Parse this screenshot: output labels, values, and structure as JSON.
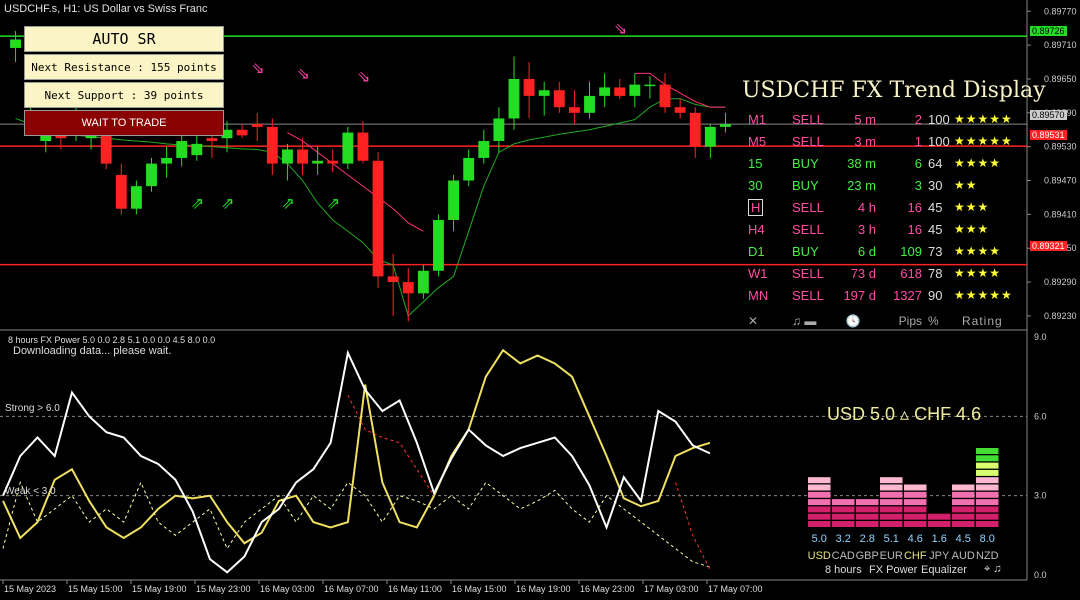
{
  "header": {
    "title": "USDCHF.s, H1:  US Dollar vs Swiss Franc"
  },
  "auto_sr": {
    "title": "AUTO SR",
    "resistance": "Next Resistance : 155 points",
    "support": "Next Support : 39 points",
    "status": "WAIT TO TRADE"
  },
  "trend_display": {
    "title": "USDCHF FX Trend Display",
    "rows": [
      {
        "tf": "M1",
        "signal": "SELL",
        "dur": "5 m",
        "pips": "2",
        "pct": "100",
        "stars": "★★★★★",
        "color": "#ff4da6"
      },
      {
        "tf": "M5",
        "signal": "SELL",
        "dur": "3 m",
        "pips": "1",
        "pct": "100",
        "stars": "★★★★★",
        "color": "#ff4da6"
      },
      {
        "tf": "15",
        "signal": "BUY",
        "dur": "38 m",
        "pips": "6",
        "pct": "64",
        "stars": "★★★★",
        "color": "#44ee44"
      },
      {
        "tf": "30",
        "signal": "BUY",
        "dur": "23 m",
        "pips": "3",
        "pct": "30",
        "stars": "★★",
        "color": "#44ee44"
      },
      {
        "tf": "H",
        "signal": "SELL",
        "dur": "4 h",
        "pips": "16",
        "pct": "45",
        "stars": "★★★",
        "color": "#ff4da6"
      },
      {
        "tf": "H4",
        "signal": "SELL",
        "dur": "3 h",
        "pips": "16",
        "pct": "45",
        "stars": "★★★",
        "color": "#ff4da6"
      },
      {
        "tf": "D1",
        "signal": "BUY",
        "dur": "6 d",
        "pips": "109",
        "pct": "73",
        "stars": "★★★★",
        "color": "#44ee44"
      },
      {
        "tf": "W1",
        "signal": "SELL",
        "dur": "73 d",
        "pips": "618",
        "pct": "78",
        "stars": "★★★★",
        "color": "#ff4da6"
      },
      {
        "tf": "MN",
        "signal": "SELL",
        "dur": "197 d",
        "pips": "1327",
        "pct": "90",
        "stars": "★★★★★",
        "color": "#ff4da6"
      }
    ],
    "footer": {
      "close": "✕",
      "sound": "♫ ▬",
      "clock": "🕓",
      "pips": "Pips",
      "pct": "%",
      "rating": "Rating"
    }
  },
  "subwindow": {
    "title": "8 hours FX Power 5.0 0.0 2.8 5.1 0.0 0.0 4.5 8.0 0.0",
    "message": "Downloading data... please wait.",
    "strong_label": "Strong > 6.0",
    "weak_label": "Weak < 3.0",
    "usd_chf": "USD 5.0  ▵  CHF 4.6",
    "footer": {
      "period": "8 hours",
      "name": "FX Power",
      "mode": "Equalizer",
      "icons": "⌖ ♫"
    }
  },
  "price_tags": {
    "resistance": "0.89726",
    "current": "0.89570",
    "mid": "0.89531",
    "support": "0.89321"
  },
  "chart_data": [
    {
      "type": "candlestick",
      "title": "USDCHF.s, H1",
      "y_ticks": [
        "0.89770",
        "0.89710",
        "0.89650",
        "0.89590",
        "0.89530",
        "0.89470",
        "0.89410",
        "0.89350",
        "0.89290",
        "0.89230"
      ],
      "ylim": [
        0.89205,
        0.8979
      ],
      "x_ticks": [
        "15 May 2023",
        "15 May 15:00",
        "15 May 19:00",
        "15 May 23:00",
        "16 May 03:00",
        "16 May 07:00",
        "16 May 11:00",
        "16 May 15:00",
        "16 May 19:00",
        "16 May 23:00",
        "17 May 03:00",
        "17 May 07:00"
      ],
      "levels": {
        "resistance": 0.89726,
        "current": 0.8957,
        "mid": 0.89531,
        "support": 0.89321
      },
      "colors": {
        "bull": "#22dd22",
        "bear": "#ff2222",
        "resistance": "#22dd22",
        "support": "#ff2222",
        "signal_line": "#22aa22"
      },
      "candles": [
        [
          0.89705,
          0.89735,
          0.8968,
          0.8972
        ],
        [
          0.896,
          0.8964,
          0.89575,
          0.89615
        ],
        [
          0.8954,
          0.8958,
          0.8952,
          0.89565
        ],
        [
          0.89555,
          0.89585,
          0.89525,
          0.89545
        ],
        [
          0.8956,
          0.896,
          0.8954,
          0.8958
        ],
        [
          0.89545,
          0.89585,
          0.89525,
          0.8956
        ],
        [
          0.8956,
          0.8958,
          0.8949,
          0.895
        ],
        [
          0.8948,
          0.895,
          0.8941,
          0.8942
        ],
        [
          0.8942,
          0.8947,
          0.8941,
          0.8946
        ],
        [
          0.8946,
          0.8951,
          0.8945,
          0.895
        ],
        [
          0.895,
          0.8953,
          0.89475,
          0.8951
        ],
        [
          0.8951,
          0.8955,
          0.89495,
          0.8954
        ],
        [
          0.89515,
          0.8956,
          0.89505,
          0.89535
        ],
        [
          0.89545,
          0.8957,
          0.8951,
          0.8954
        ],
        [
          0.89545,
          0.89575,
          0.8952,
          0.8956
        ],
        [
          0.8956,
          0.8957,
          0.89545,
          0.8955
        ],
        [
          0.8957,
          0.8959,
          0.8954,
          0.89565
        ],
        [
          0.89565,
          0.8958,
          0.8948,
          0.895
        ],
        [
          0.895,
          0.89535,
          0.8947,
          0.89525
        ],
        [
          0.89525,
          0.89545,
          0.8948,
          0.895
        ],
        [
          0.895,
          0.8953,
          0.8948,
          0.89505
        ],
        [
          0.89505,
          0.89525,
          0.89485,
          0.895
        ],
        [
          0.895,
          0.89565,
          0.8949,
          0.89555
        ],
        [
          0.89555,
          0.89575,
          0.895,
          0.89505
        ],
        [
          0.89505,
          0.8952,
          0.8928,
          0.893
        ],
        [
          0.893,
          0.8934,
          0.8923,
          0.8929
        ],
        [
          0.8929,
          0.89315,
          0.8922,
          0.8927
        ],
        [
          0.8927,
          0.8932,
          0.8926,
          0.8931
        ],
        [
          0.8931,
          0.8941,
          0.893,
          0.894
        ],
        [
          0.894,
          0.8948,
          0.8938,
          0.8947
        ],
        [
          0.8947,
          0.89525,
          0.8946,
          0.8951
        ],
        [
          0.8951,
          0.8956,
          0.895,
          0.8954
        ],
        [
          0.8954,
          0.896,
          0.8952,
          0.8958
        ],
        [
          0.8958,
          0.8969,
          0.8956,
          0.8965
        ],
        [
          0.8965,
          0.8968,
          0.8958,
          0.8962
        ],
        [
          0.8962,
          0.89645,
          0.89585,
          0.8963
        ],
        [
          0.8963,
          0.89645,
          0.8959,
          0.896
        ],
        [
          0.896,
          0.8963,
          0.8957,
          0.8959
        ],
        [
          0.8959,
          0.89645,
          0.8958,
          0.8962
        ],
        [
          0.8962,
          0.8966,
          0.896,
          0.89635
        ],
        [
          0.89635,
          0.8965,
          0.89615,
          0.8962
        ],
        [
          0.8962,
          0.8966,
          0.896,
          0.8964
        ],
        [
          0.8964,
          0.89655,
          0.89615,
          0.8964
        ],
        [
          0.8964,
          0.8966,
          0.8959,
          0.896
        ],
        [
          0.896,
          0.89615,
          0.8958,
          0.8959
        ],
        [
          0.8959,
          0.896,
          0.8951,
          0.8953
        ],
        [
          0.8953,
          0.8957,
          0.8951,
          0.89565
        ],
        [
          0.89565,
          0.8959,
          0.89555,
          0.8957
        ]
      ],
      "signal_line": [
        0.8958,
        0.8957,
        0.8956,
        0.89555,
        0.8955,
        0.89548,
        0.89545,
        0.89542,
        0.8954,
        0.89538,
        0.89535,
        0.89533,
        0.89532,
        0.8953,
        0.89528,
        0.89526,
        0.89525,
        0.8952,
        0.895,
        0.8947,
        0.8943,
        0.894,
        0.8938,
        0.8936,
        0.8933,
        0.8932,
        0.8923,
        0.89255,
        0.8928,
        0.893,
        0.8938,
        0.8946,
        0.8952,
        0.89535,
        0.89542,
        0.89547,
        0.89552,
        0.89556,
        0.8956,
        0.89566,
        0.89572,
        0.89578,
        0.896,
        0.89615,
        0.89615,
        0.89605,
        0.896,
        0.896
      ],
      "pink_line": [
        null,
        null,
        null,
        null,
        null,
        null,
        null,
        null,
        null,
        null,
        null,
        null,
        null,
        null,
        null,
        null,
        null,
        null,
        0.89555,
        0.8954,
        0.8952,
        0.895,
        0.8948,
        0.8946,
        0.8944,
        0.8942,
        0.89395,
        0.8938,
        null,
        null,
        null,
        null,
        null,
        null,
        null,
        null,
        null,
        null,
        null,
        null,
        null,
        0.8966,
        0.8966,
        0.8964,
        0.89625,
        0.8961,
        0.896,
        0.896
      ],
      "buy_arrows": [
        [
          5,
          0.8957
        ],
        [
          12,
          0.8942
        ],
        [
          14,
          0.8942
        ],
        [
          18,
          0.8942
        ],
        [
          21,
          0.8942
        ]
      ],
      "sell_arrows": [
        [
          16,
          0.8966
        ],
        [
          19,
          0.8965
        ],
        [
          23,
          0.89645
        ],
        [
          40,
          0.8973
        ]
      ]
    },
    {
      "type": "line",
      "title": "8 hours FX Power",
      "ylim": [
        0,
        9
      ],
      "y_ticks": [
        "9.0",
        "6.0",
        "3.0",
        "0.0"
      ],
      "levels": {
        "strong": 6.0,
        "weak": 3.0
      },
      "series": [
        {
          "name": "USD",
          "color": "#f0e060",
          "values": [
            2.8,
            1.4,
            2.0,
            3.6,
            4.0,
            2.8,
            1.8,
            1.4,
            1.8,
            2.5,
            3.0,
            2.9,
            3.0,
            2.0,
            1.2,
            1.6,
            2.8,
            3.0,
            2.0,
            1.8,
            2.0,
            7.2,
            3.5,
            2.0,
            1.8,
            3.0,
            4.5,
            5.5,
            7.5,
            8.5,
            8.0,
            8.3,
            8.0,
            7.5,
            6.0,
            4.5,
            2.9,
            2.6,
            2.8,
            4.5,
            4.8,
            5.0
          ]
        },
        {
          "name": "CHF",
          "color": "#ffffff",
          "values": [
            3.0,
            4.5,
            5.2,
            4.5,
            6.9,
            6.0,
            5.4,
            5.2,
            4.5,
            4.2,
            3.6,
            2.4,
            0.6,
            0.1,
            0.7,
            2.0,
            2.5,
            3.5,
            4.0,
            5.0,
            8.4,
            7.0,
            6.2,
            6.6,
            5.0,
            3.1,
            4.4,
            5.5,
            4.9,
            4.5,
            4.8,
            5.0,
            5.2,
            4.5,
            3.4,
            1.8,
            3.7,
            2.8,
            6.2,
            5.8,
            4.9,
            4.6
          ]
        },
        {
          "name": "",
          "color": "#ffffaa",
          "dashed": true,
          "values": [
            1.0,
            3.5,
            2.0,
            2.5,
            3.0,
            2.0,
            2.5,
            2.0,
            3.5,
            2.0,
            1.5,
            2.0,
            2.5,
            1.0,
            2.0,
            2.5,
            3.0,
            2.0,
            3.0,
            2.5,
            3.5,
            3.0,
            2.0,
            3.0,
            2.8,
            2.5,
            3.0,
            2.5,
            3.5,
            3.0,
            2.5,
            2.8,
            3.2,
            2.5,
            2.0,
            3.0,
            2.5,
            2.0,
            1.5,
            1.0,
            0.5,
            0.3
          ]
        },
        {
          "name": "",
          "color": "#ff3333",
          "dashed": true,
          "values": [
            null,
            null,
            null,
            null,
            null,
            null,
            null,
            null,
            null,
            null,
            null,
            null,
            null,
            null,
            null,
            null,
            null,
            null,
            null,
            null,
            6.8,
            5.5,
            5.2,
            5.0,
            4.0,
            3.0,
            null,
            null,
            null,
            null,
            null,
            null,
            null,
            null,
            null,
            null,
            null,
            null,
            null,
            3.5,
            1.5,
            0.2
          ]
        }
      ]
    },
    {
      "type": "bar",
      "title": "Equalizer",
      "categories": [
        "USD",
        "CAD",
        "GBP",
        "EUR",
        "CHF",
        "JPY",
        "AUD",
        "NZD"
      ],
      "values": [
        5.0,
        3.2,
        2.8,
        5.1,
        4.6,
        1.6,
        4.5,
        8.0
      ],
      "value_labels": [
        "5.0",
        "3.2",
        "2.8",
        "5.1",
        "4.6",
        "1.6",
        "4.5",
        "8.0"
      ],
      "highlight": [
        "USD",
        "CHF"
      ],
      "colors": {
        "low": "#d0206a",
        "mid": "#f070b0",
        "high": "#ffc0d0",
        "top": "#c8ff60",
        "selected": "#e6e080"
      }
    }
  ]
}
